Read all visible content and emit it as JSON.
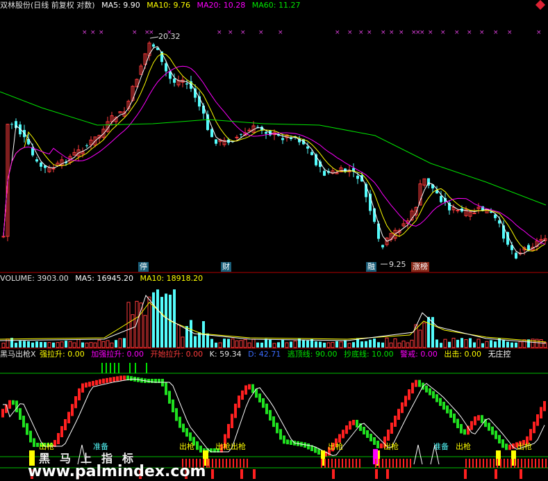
{
  "header": {
    "stock_title": "双林股份(日线 前复权 对数)",
    "ma5": "MA5: 9.90",
    "ma10": "MA10: 9.76",
    "ma20": "MA20: 10.28",
    "ma60": "MA60: 11.27"
  },
  "price_panel": {
    "high_label": "20.32",
    "low_label": "9.25",
    "markers": [
      {
        "text": "停"
      },
      {
        "text": "财"
      },
      {
        "text": "融"
      },
      {
        "text": "涨榜"
      }
    ]
  },
  "volume_header": {
    "volume": "VOLUME: 3903.00",
    "ma5": "MA5: 16945.20",
    "ma10": "MA10: 18918.20"
  },
  "indicator_header": {
    "name": "黑马出枪X",
    "items": [
      {
        "label": "强拉升: 0.00"
      },
      {
        "label": "加强拉升: 0.00"
      },
      {
        "label": "开始拉升: 0.00"
      },
      {
        "label": "K: 59.34"
      },
      {
        "label": "D: 42.71"
      },
      {
        "label": "逃顶线: 90.00"
      },
      {
        "label": "抄底线: 10.00"
      },
      {
        "label": "警戒: 0.00"
      },
      {
        "label": "出击: 0.00"
      },
      {
        "label": "无庄控"
      }
    ]
  },
  "indicator_labels": {
    "chuqiang": "出枪",
    "zhunbei": "准备"
  },
  "watermark": {
    "slogan": "黑马上指标",
    "site": "www.palmindex.com"
  },
  "colors": {
    "up": "#ff3c3c",
    "down": "#54fcfc",
    "ma5": "#ffffff",
    "ma10": "#ffff00",
    "ma20": "#ff00ff",
    "ma60": "#00e600",
    "separator": "#b00000",
    "indicator_line": "#ffffff",
    "k_up": "#ff2020",
    "k_down": "#20e020"
  }
}
